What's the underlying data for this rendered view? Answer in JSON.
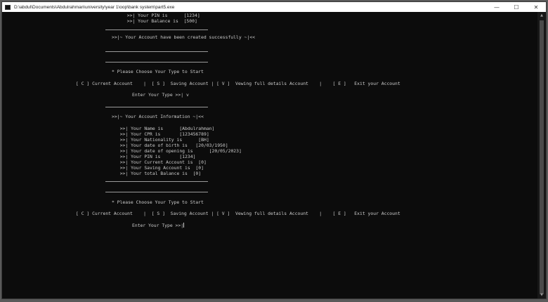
{
  "window": {
    "title": "D:\\abdul\\Documents\\Abdulrahman\\university\\year 1\\oop\\bank system\\part5.exe",
    "controls": {
      "minimize": "—",
      "maximize": "☐",
      "close": "✕"
    }
  },
  "console": {
    "top_pin": "        >>| Your PIN is      [1234]",
    "top_balance": "        >>| Your Balance is  [500]",
    "created_msg": ">>|~ Your Account have been created successfully ~|<<",
    "prompt_choose_1": "* Please Choose Your Type to Start",
    "menu_1": "[ C ] Current Account    |  [ S ]  Saving Account | [ V ]  Vewing full details Account    |    [ E ]   Exit your Account",
    "enter_type_1": "Enter Your Type >>| v",
    "info_header": ">>|~ Your Account Information ~|<<",
    "info_lines": [
      "  >>| Your Name is      [Abdulrahman]",
      "  >>| Your CPR is       [123456789]",
      "  >>| Your Nationality is      [BH]",
      "  >>| Your date of birth is   [20/03/1950]",
      "  >>| Your date of opening is      [20/05/2023]",
      "  >>| Your PIN is       [1234]",
      "  >>| Your Current Account is  [0]",
      "  >>| Your Saving Account is  [0]",
      "  >>| Your total Balance is  [0]"
    ],
    "prompt_choose_2": "* Please Choose Your Type to Start",
    "menu_2": "[ C ] Current Account    |  [ S ]  Saving Account | [ V ]  Vewing full details Account    |    [ E ]   Exit your Account",
    "enter_type_2": "Enter Your Type >>|"
  },
  "scrollbar": {
    "up_icon": "▲",
    "down_icon": "▼"
  }
}
